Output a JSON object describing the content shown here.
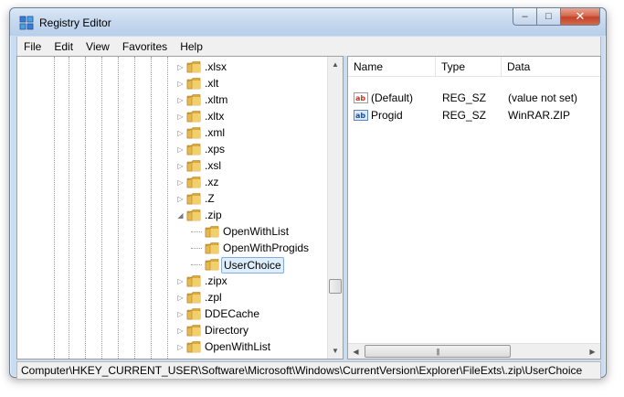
{
  "window": {
    "title": "Registry Editor",
    "icon": "registry-icon"
  },
  "caption": {
    "minimize": "–",
    "maximize": "□",
    "close": "✕"
  },
  "menu": [
    "File",
    "Edit",
    "View",
    "Favorites",
    "Help"
  ],
  "tree": [
    {
      "label": ".xlsx",
      "level": 0,
      "expander": "collapsed"
    },
    {
      "label": ".xlt",
      "level": 0,
      "expander": "collapsed"
    },
    {
      "label": ".xltm",
      "level": 0,
      "expander": "collapsed"
    },
    {
      "label": ".xltx",
      "level": 0,
      "expander": "collapsed"
    },
    {
      "label": ".xml",
      "level": 0,
      "expander": "collapsed"
    },
    {
      "label": ".xps",
      "level": 0,
      "expander": "collapsed"
    },
    {
      "label": ".xsl",
      "level": 0,
      "expander": "collapsed"
    },
    {
      "label": ".xz",
      "level": 0,
      "expander": "collapsed"
    },
    {
      "label": ".Z",
      "level": 0,
      "expander": "collapsed"
    },
    {
      "label": ".zip",
      "level": 0,
      "expander": "expanded"
    },
    {
      "label": "OpenWithList",
      "level": 1,
      "expander": "none"
    },
    {
      "label": "OpenWithProgids",
      "level": 1,
      "expander": "none"
    },
    {
      "label": "UserChoice",
      "level": 1,
      "expander": "none",
      "selected": true
    },
    {
      "label": ".zipx",
      "level": 0,
      "expander": "collapsed"
    },
    {
      "label": ".zpl",
      "level": 0,
      "expander": "collapsed"
    },
    {
      "label": "DDECache",
      "level": 0,
      "expander": "collapsed"
    },
    {
      "label": "Directory",
      "level": 0,
      "expander": "collapsed"
    },
    {
      "label": "OpenWithList",
      "level": 0,
      "expander": "collapsed"
    }
  ],
  "list": {
    "columns": [
      "Name",
      "Type",
      "Data"
    ],
    "rows": [
      {
        "icon": "string-value-icon",
        "name": "(Default)",
        "type": "REG_SZ",
        "data": "(value not set)"
      },
      {
        "icon": "string-value-icon",
        "name": "Progid",
        "type": "REG_SZ",
        "data": "WinRAR.ZIP"
      }
    ]
  },
  "status": {
    "path": "Computer\\HKEY_CURRENT_USER\\Software\\Microsoft\\Windows\\CurrentVersion\\Explorer\\FileExts\\.zip\\UserChoice"
  },
  "colors": {
    "selection_bg": "#dfeefc",
    "selection_border": "#84acdd",
    "folder": "#e8c25a",
    "close_button": "#c3432a"
  }
}
